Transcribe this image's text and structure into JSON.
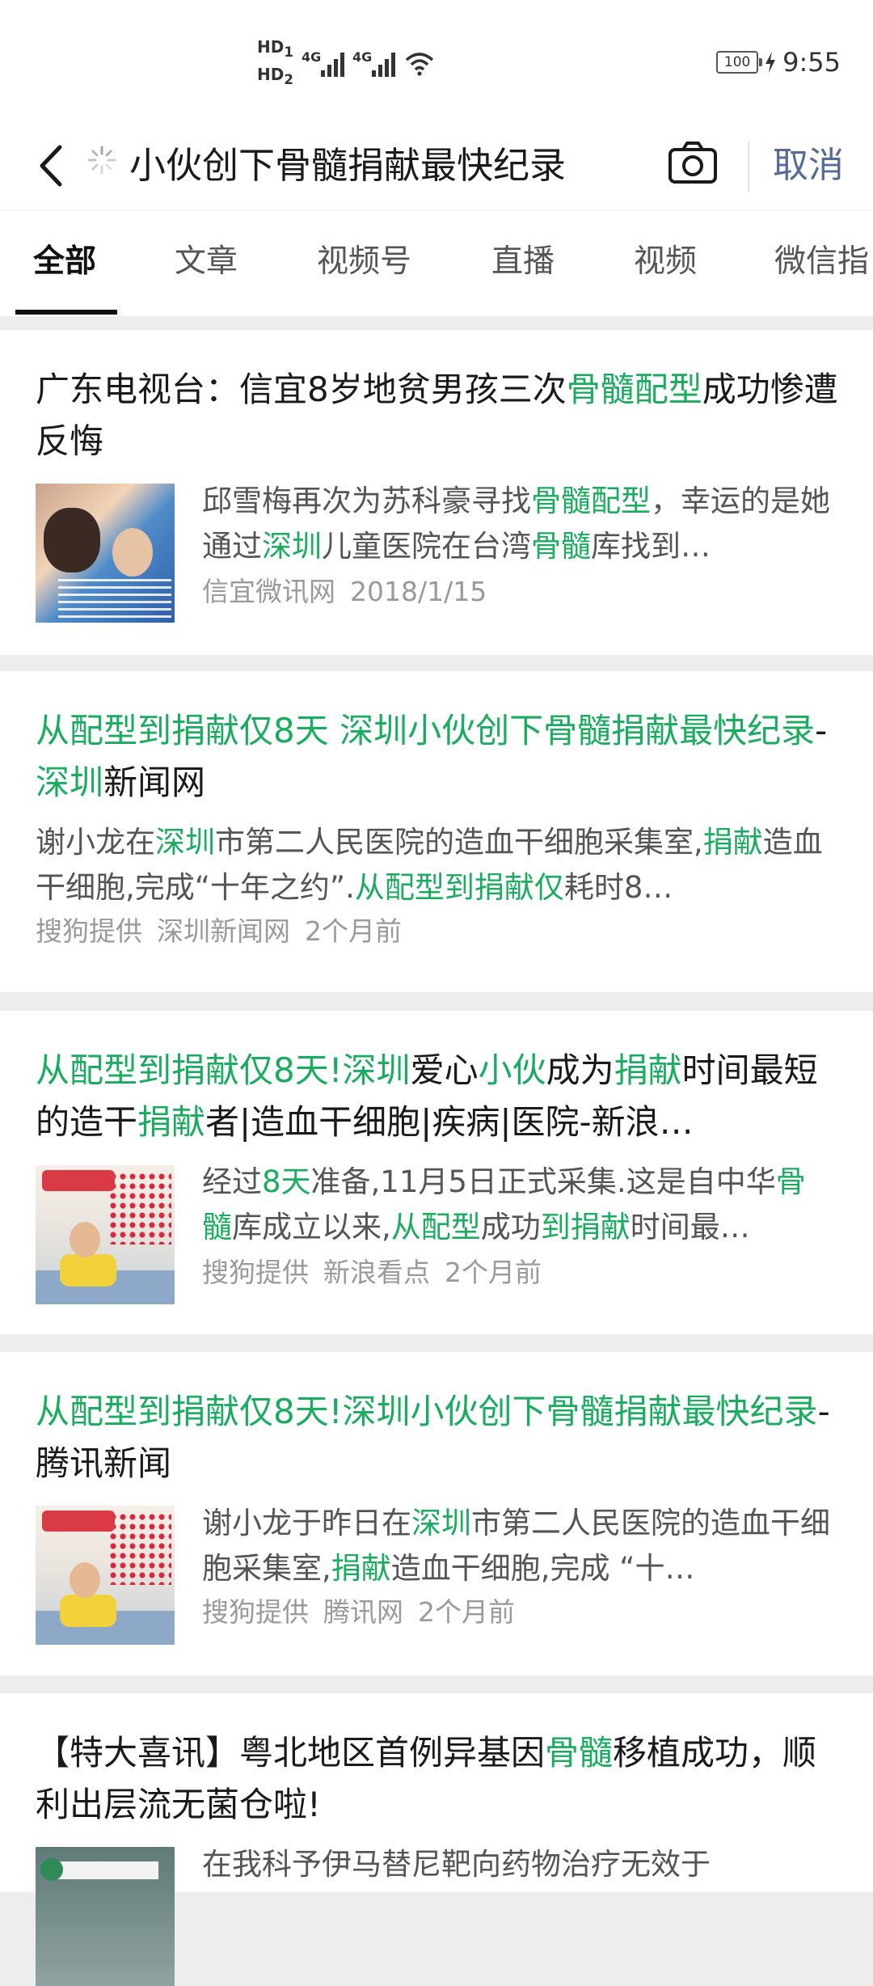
{
  "status_bar": {
    "sim1": "HD",
    "sim1_index": "1",
    "sim2": "HD",
    "sim2_index": "2",
    "network1": "4G",
    "network2": "4G",
    "battery": "100",
    "time": "9:55"
  },
  "search": {
    "query": "小伙创下骨髓捐献最快纪录",
    "cancel_label": "取消"
  },
  "tabs": [
    {
      "label": "全部",
      "active": true
    },
    {
      "label": "文章",
      "active": false
    },
    {
      "label": "视频号",
      "active": false
    },
    {
      "label": "直播",
      "active": false
    },
    {
      "label": "视频",
      "active": false
    },
    {
      "label": "微信指",
      "active": false
    }
  ],
  "colors": {
    "highlight": "#1aad5f",
    "link_blue": "#576b95"
  },
  "results": [
    {
      "title": [
        {
          "t": "广东电视台：信宜8岁地贫男孩三次"
        },
        {
          "t": "骨髓配型",
          "hl": true
        },
        {
          "t": "成功惨遭反悔"
        }
      ],
      "summary": [
        {
          "t": "邱雪梅再次为苏科豪寻找"
        },
        {
          "t": "骨髓配型",
          "hl": true
        },
        {
          "t": "，幸运的是她通过"
        },
        {
          "t": "深圳",
          "hl": true
        },
        {
          "t": "儿童医院在台湾"
        },
        {
          "t": "骨髓",
          "hl": true
        },
        {
          "t": "库找到…"
        }
      ],
      "source": "信宜微讯网",
      "date": "2018/1/15",
      "thumb": "mother-and-child-photo"
    },
    {
      "title": [
        {
          "t": "从配型到捐献仅8天 深圳小伙创下骨髓捐献最快纪录",
          "hl": true
        },
        {
          "t": "-"
        },
        {
          "t": "深圳",
          "hl": true
        },
        {
          "t": "新闻网"
        }
      ],
      "summary": [
        {
          "t": "谢小龙在"
        },
        {
          "t": "深圳",
          "hl": true
        },
        {
          "t": "市第二人民医院的造血干细胞采集室,"
        },
        {
          "t": "捐献",
          "hl": true
        },
        {
          "t": "造血干细胞,完成“十年之约”."
        },
        {
          "t": "从配型到捐献仅",
          "hl": true
        },
        {
          "t": "耗时8…"
        }
      ],
      "provider": "搜狗提供",
      "source": "深圳新闻网",
      "date": "2个月前"
    },
    {
      "title": [
        {
          "t": "从配型到捐献仅8天!深圳",
          "hl": true
        },
        {
          "t": "爱心"
        },
        {
          "t": "小伙",
          "hl": true
        },
        {
          "t": "成为"
        },
        {
          "t": "捐献",
          "hl": true
        },
        {
          "t": "时间最短的造干"
        },
        {
          "t": "捐献",
          "hl": true
        },
        {
          "t": "者|造血干细胞|疾病|医院-新浪…"
        }
      ],
      "summary": [
        {
          "t": "经过"
        },
        {
          "t": "8天",
          "hl": true
        },
        {
          "t": "准备,11月5日正式采集.这是自中华"
        },
        {
          "t": "骨髓",
          "hl": true
        },
        {
          "t": "库成立以来,"
        },
        {
          "t": "从配型",
          "hl": true
        },
        {
          "t": "成功"
        },
        {
          "t": "到捐献",
          "hl": true
        },
        {
          "t": "时间最…"
        }
      ],
      "provider": "搜狗提供",
      "source": "新浪看点",
      "date": "2个月前",
      "thumb": "donor-in-hospital-bed-photo"
    },
    {
      "title": [
        {
          "t": "从配型到捐献仅8天!深圳小伙创下骨髓捐献最快纪录",
          "hl": true
        },
        {
          "t": "-腾讯新闻"
        }
      ],
      "summary": [
        {
          "t": "谢小龙于昨日在"
        },
        {
          "t": "深圳",
          "hl": true
        },
        {
          "t": "市第二人民医院的造血干细胞采集室,"
        },
        {
          "t": "捐献",
          "hl": true
        },
        {
          "t": "造血干细胞,完成 “十…"
        }
      ],
      "provider": "搜狗提供",
      "source": "腾讯网",
      "date": "2个月前",
      "thumb": "donor-in-hospital-bed-photo"
    },
    {
      "title": [
        {
          "t": "【特大喜讯】粤北地区首例异基因"
        },
        {
          "t": "骨髓",
          "hl": true
        },
        {
          "t": "移植成功，顺利出层流无菌仓啦!"
        }
      ],
      "summary": [
        {
          "t": "在我科予伊马替尼靶向药物治疗无效于"
        }
      ],
      "thumb": "hospital-center-sign-photo"
    }
  ]
}
